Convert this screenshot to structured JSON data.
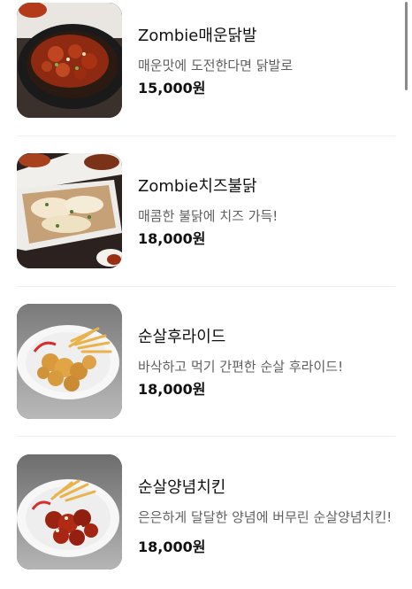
{
  "menu": {
    "items": [
      {
        "name": "Zombie매운닭발",
        "description": "매운맛에 도전한다면 닭발로",
        "price": "15,000원",
        "image": "spicy-chicken-feet-photo"
      },
      {
        "name": "Zombie치즈불닭",
        "description": "매콤한 불닭에 치즈 가득!",
        "price": "18,000원",
        "image": "cheese-fire-chicken-photo"
      },
      {
        "name": "순살후라이드",
        "description": "바삭하고 먹기 간편한 순살 후라이드!",
        "price": "18,000원",
        "image": "boneless-fried-chicken-photo"
      },
      {
        "name": "순살양념치킨",
        "description": "은은하게 달달한 양념에 버무린 순살양념치킨!",
        "price": "18,000원",
        "image": "boneless-seasoned-chicken-photo"
      }
    ]
  },
  "colors": {
    "text_primary": "#111111",
    "text_secondary": "#5f5f5f",
    "divider": "#eeeeee"
  }
}
